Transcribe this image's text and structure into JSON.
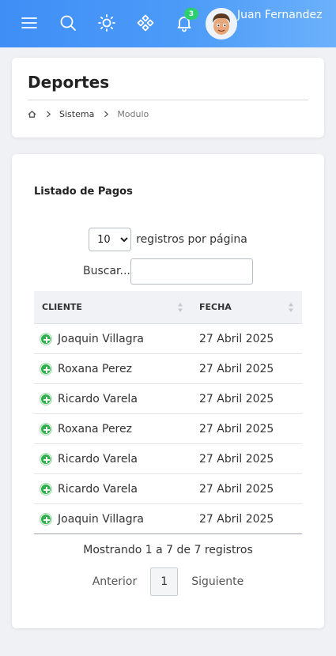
{
  "header": {
    "notification_count": "3",
    "user_name": "Juan Fernandez",
    "icons": [
      "menu-icon",
      "search-icon",
      "sun-icon",
      "apps-icon",
      "bell-icon"
    ]
  },
  "page": {
    "title": "Deportes",
    "breadcrumb": [
      "Sistema",
      "Modulo"
    ]
  },
  "listing": {
    "title": "Listado de Pagos",
    "page_length": "10",
    "page_length_options": [
      "10"
    ],
    "length_suffix": "registros por página",
    "search_label": "Buscar...",
    "search_value": "",
    "columns": [
      "CLIENTE",
      "FECHA"
    ],
    "rows": [
      {
        "client": "Joaquin Villagra",
        "date": "27 Abril 2025"
      },
      {
        "client": "Roxana Perez",
        "date": "27 Abril 2025"
      },
      {
        "client": "Ricardo Varela",
        "date": "27 Abril 2025"
      },
      {
        "client": "Roxana Perez",
        "date": "27 Abril 2025"
      },
      {
        "client": "Ricardo Varela",
        "date": "27 Abril 2025"
      },
      {
        "client": "Ricardo Varela",
        "date": "27 Abril 2025"
      },
      {
        "client": "Joaquin Villagra",
        "date": "27 Abril 2025"
      }
    ],
    "info": "Mostrando 1 a 7 de 7 registros",
    "pager": {
      "prev": "Anterior",
      "page": "1",
      "next": "Siguiente"
    }
  },
  "colors": {
    "header_start": "#3f8ef6",
    "header_end": "#6cb1fb",
    "badge": "#2ccf6d",
    "expand": "#2fb04b"
  }
}
